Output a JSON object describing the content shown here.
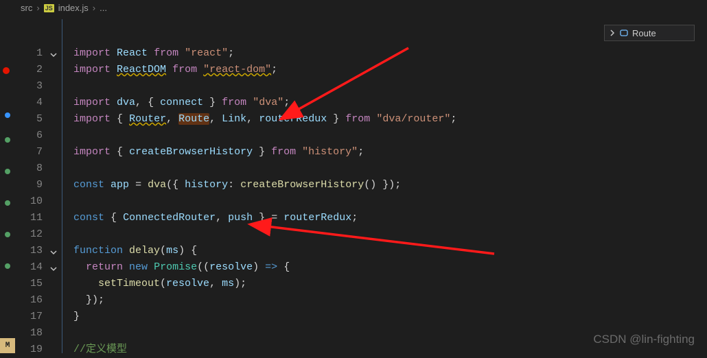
{
  "breadcrumb": {
    "folder": "src",
    "badge": "JS",
    "file": "index.js",
    "tail": "..."
  },
  "outline": {
    "label": "Route"
  },
  "gutter": {
    "dot1": "U",
    "dot2": "U",
    "dot3": "U",
    "dot4": "U",
    "dot5": "U",
    "dot6": "U",
    "bottom": "M"
  },
  "code": {
    "lines": [
      {
        "n": 1,
        "fold": true,
        "tokens": [
          [
            "kw",
            "import"
          ],
          [
            "",
            ""
          ],
          [
            "var",
            "React"
          ],
          [
            "",
            ""
          ],
          [
            "kw",
            "from"
          ],
          [
            "",
            ""
          ],
          [
            "str",
            "\"react\""
          ],
          [
            "punc",
            ";"
          ]
        ]
      },
      {
        "n": 2,
        "bp": true,
        "tokens": [
          [
            "kw",
            "import"
          ],
          [
            "",
            ""
          ],
          [
            "var warn",
            "ReactDOM"
          ],
          [
            "",
            ""
          ],
          [
            "kw",
            "from"
          ],
          [
            "",
            ""
          ],
          [
            "str warn",
            "\"react-dom\""
          ],
          [
            "punc",
            ";"
          ]
        ]
      },
      {
        "n": 3,
        "tokens": []
      },
      {
        "n": 4,
        "tokens": [
          [
            "kw",
            "import"
          ],
          [
            "",
            ""
          ],
          [
            "var",
            "dva"
          ],
          [
            "punc",
            ","
          ],
          [
            "",
            ""
          ],
          [
            "punc",
            "{"
          ],
          [
            "",
            ""
          ],
          [
            "var",
            "connect"
          ],
          [
            "",
            ""
          ],
          [
            "punc",
            "}"
          ],
          [
            "",
            ""
          ],
          [
            "kw",
            "from"
          ],
          [
            "",
            ""
          ],
          [
            "str",
            "\"dva\""
          ],
          [
            "punc",
            ";"
          ]
        ]
      },
      {
        "n": 5,
        "tokens": [
          [
            "kw",
            "import"
          ],
          [
            "",
            ""
          ],
          [
            "punc",
            "{"
          ],
          [
            "",
            ""
          ],
          [
            "var warn",
            "Router"
          ],
          [
            "punc",
            ","
          ],
          [
            "",
            ""
          ],
          [
            "var sel",
            "Route"
          ],
          [
            "punc",
            ","
          ],
          [
            "",
            ""
          ],
          [
            "var",
            "Link"
          ],
          [
            "punc",
            ","
          ],
          [
            "",
            ""
          ],
          [
            "var",
            "routerRedux"
          ],
          [
            "",
            ""
          ],
          [
            "punc",
            "}"
          ],
          [
            "",
            ""
          ],
          [
            "kw",
            "from"
          ],
          [
            "",
            ""
          ],
          [
            "str",
            "\"dva/router\""
          ],
          [
            "punc",
            ";"
          ]
        ]
      },
      {
        "n": 6,
        "tokens": []
      },
      {
        "n": 7,
        "tokens": [
          [
            "kw",
            "import"
          ],
          [
            "",
            ""
          ],
          [
            "punc",
            "{"
          ],
          [
            "",
            ""
          ],
          [
            "var",
            "createBrowserHistory"
          ],
          [
            "",
            ""
          ],
          [
            "punc",
            "}"
          ],
          [
            "",
            ""
          ],
          [
            "kw",
            "from"
          ],
          [
            "",
            ""
          ],
          [
            "str",
            "\"history\""
          ],
          [
            "punc",
            ";"
          ]
        ]
      },
      {
        "n": 8,
        "tokens": []
      },
      {
        "n": 9,
        "tokens": [
          [
            "const",
            "const"
          ],
          [
            "",
            ""
          ],
          [
            "var",
            "app"
          ],
          [
            "",
            ""
          ],
          [
            "punc",
            "="
          ],
          [
            "",
            ""
          ],
          [
            "fn",
            "dva"
          ],
          [
            "punc",
            "({"
          ],
          [
            "",
            ""
          ],
          [
            "var",
            "history"
          ],
          [
            "punc",
            ":"
          ],
          [
            "",
            ""
          ],
          [
            "fn",
            "createBrowserHistory"
          ],
          [
            "punc",
            "()"
          ],
          [
            "",
            ""
          ],
          [
            "punc",
            "});"
          ]
        ]
      },
      {
        "n": 10,
        "tokens": []
      },
      {
        "n": 11,
        "tokens": [
          [
            "const",
            "const"
          ],
          [
            "",
            ""
          ],
          [
            "punc",
            "{"
          ],
          [
            "",
            ""
          ],
          [
            "var",
            "ConnectedRouter"
          ],
          [
            "punc",
            ","
          ],
          [
            "",
            ""
          ],
          [
            "var",
            "push"
          ],
          [
            "",
            ""
          ],
          [
            "punc",
            "}"
          ],
          [
            "",
            ""
          ],
          [
            "punc",
            "="
          ],
          [
            "",
            ""
          ],
          [
            "var",
            "routerRedux"
          ],
          [
            "punc",
            ";"
          ]
        ]
      },
      {
        "n": 12,
        "tokens": []
      },
      {
        "n": 13,
        "fold": true,
        "tokens": [
          [
            "const",
            "function"
          ],
          [
            "",
            ""
          ],
          [
            "fn",
            "delay"
          ],
          [
            "punc",
            "("
          ],
          [
            "var",
            "ms"
          ],
          [
            "punc",
            ")"
          ],
          [
            "",
            ""
          ],
          [
            "punc",
            "{"
          ]
        ]
      },
      {
        "n": 14,
        "fold": true,
        "indent": 1,
        "tokens": [
          [
            "kw",
            "return"
          ],
          [
            "",
            ""
          ],
          [
            "const",
            "new"
          ],
          [
            "",
            ""
          ],
          [
            "type",
            "Promise"
          ],
          [
            "punc",
            "(("
          ],
          [
            "var",
            "resolve"
          ],
          [
            "punc",
            ")"
          ],
          [
            "",
            ""
          ],
          [
            "const",
            "=>"
          ],
          [
            "",
            ""
          ],
          [
            "punc",
            "{"
          ]
        ]
      },
      {
        "n": 15,
        "indent": 2,
        "tokens": [
          [
            "fn",
            "setTimeout"
          ],
          [
            "punc",
            "("
          ],
          [
            "var",
            "resolve"
          ],
          [
            "punc",
            ","
          ],
          [
            "",
            ""
          ],
          [
            "var",
            "ms"
          ],
          [
            "punc",
            ");"
          ]
        ]
      },
      {
        "n": 16,
        "indent": 1,
        "tokens": [
          [
            "punc",
            "});"
          ]
        ]
      },
      {
        "n": 17,
        "tokens": [
          [
            "punc",
            "}"
          ]
        ]
      },
      {
        "n": 18,
        "tokens": []
      },
      {
        "n": 19,
        "tokens": [
          [
            "comment",
            "//定义模型"
          ]
        ]
      }
    ]
  },
  "watermark": "CSDN @lin-fighting"
}
